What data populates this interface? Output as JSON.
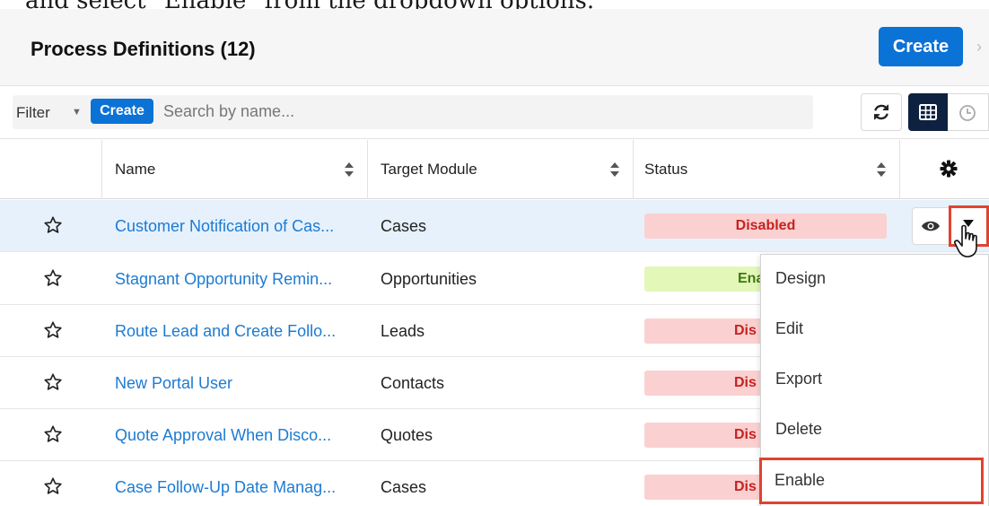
{
  "caption": "and select \"Enable\" from the dropdown options.",
  "header": {
    "title": "Process Definitions (12)",
    "create_label": "Create"
  },
  "filter_bar": {
    "filter_label": "Filter",
    "create_label": "Create",
    "search_placeholder": "Search by name..."
  },
  "columns": {
    "name": "Name",
    "target_module": "Target Module",
    "status": "Status"
  },
  "rows": [
    {
      "name": "Customer Notification of Cas...",
      "module": "Cases",
      "status": "Disabled"
    },
    {
      "name": "Stagnant Opportunity Remin...",
      "module": "Opportunities",
      "status": "Ena"
    },
    {
      "name": "Route Lead and Create Follo...",
      "module": "Leads",
      "status": "Dis"
    },
    {
      "name": "New Portal User",
      "module": "Contacts",
      "status": "Dis"
    },
    {
      "name": "Quote Approval When Disco...",
      "module": "Quotes",
      "status": "Dis"
    },
    {
      "name": "Case Follow-Up Date Manag...",
      "module": "Cases",
      "status": "Dis"
    }
  ],
  "dropdown": {
    "items": [
      "Design",
      "Edit",
      "Export",
      "Delete",
      "Enable"
    ]
  },
  "colors": {
    "accent": "#0b72d6",
    "link": "#1c7bd3",
    "disabled_bg": "#fbd0d0",
    "disabled_text": "#c52222",
    "enabled_bg": "#e3f7b8",
    "highlight": "#e0432f",
    "row_selected": "#e6f1fc"
  }
}
